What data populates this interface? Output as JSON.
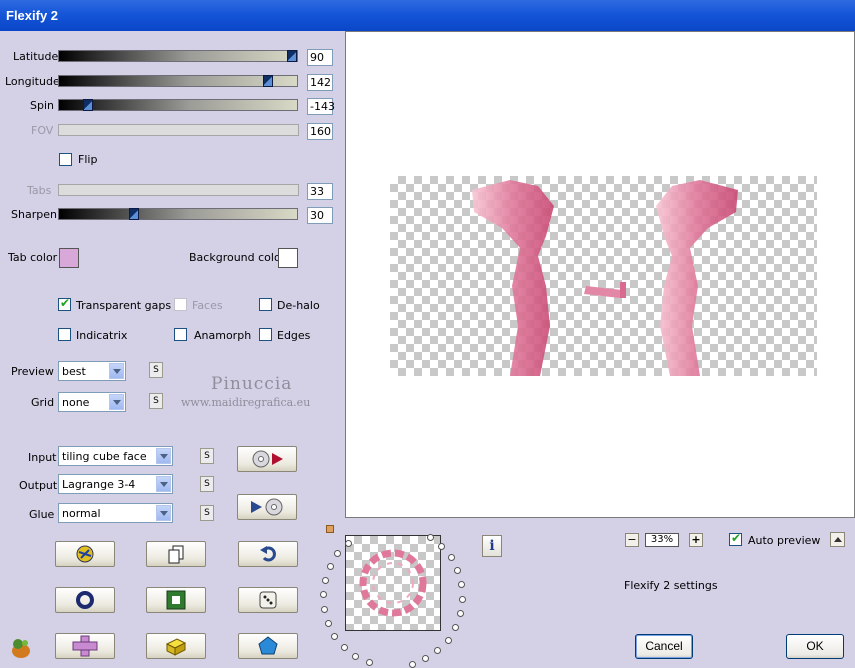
{
  "window": {
    "title": "Flexify 2"
  },
  "sliders": [
    {
      "label": "Latitude",
      "value": "90",
      "enabled": true,
      "level": 0.99
    },
    {
      "label": "Longitude",
      "value": "142",
      "enabled": true,
      "level": 0.89
    },
    {
      "label": "Spin",
      "value": "-143",
      "enabled": true,
      "level": 0.11
    },
    {
      "label": "FOV",
      "value": "160",
      "enabled": false
    },
    {
      "label": "Tabs",
      "value": "33",
      "enabled": false
    },
    {
      "label": "Sharpen",
      "value": "30",
      "enabled": true,
      "level": 0.31
    }
  ],
  "flip": {
    "label": "Flip",
    "checked": false
  },
  "tab_color": {
    "label": "Tab color",
    "color": "#D8A8D8"
  },
  "background_color": {
    "label": "Background color",
    "color": "#FFFFFF"
  },
  "options": {
    "transparent_gaps": {
      "label": "Transparent gaps",
      "checked": true
    },
    "faces": {
      "label": "Faces",
      "checked": false,
      "enabled": false
    },
    "de_halo": {
      "label": "De-halo",
      "checked": false
    },
    "indicatrix": {
      "label": "Indicatrix",
      "checked": false
    },
    "anamorph": {
      "label": "Anamorph",
      "checked": false
    },
    "edges": {
      "label": "Edges",
      "checked": false
    }
  },
  "preview_select": {
    "label": "Preview",
    "value": "best"
  },
  "grid_select": {
    "label": "Grid",
    "value": "none"
  },
  "input_select": {
    "label": "Input",
    "value": "tiling cube face"
  },
  "output_select": {
    "label": "Output",
    "value": "Lagrange 3-4"
  },
  "glue_select": {
    "label": "Glue",
    "value": "normal"
  },
  "small_button_label": "S",
  "watermark": {
    "name": "Pinuccia",
    "url": "www.maidiregrafica.eu"
  },
  "zoom": {
    "value": "33%",
    "minus": "−",
    "plus": "+"
  },
  "auto_preview": {
    "label": "Auto preview",
    "checked": true
  },
  "info_label": "i",
  "settings_label": "Flexify 2 settings",
  "buttons": {
    "cancel": "Cancel",
    "ok": "OK"
  },
  "colors": {
    "accent": "#1555D8",
    "dialog_bg": "#D4D0E6",
    "pink": "#E0789A"
  }
}
